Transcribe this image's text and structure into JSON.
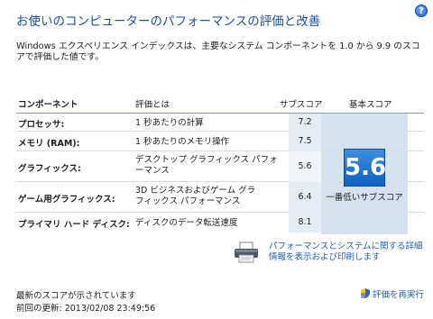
{
  "header": {
    "title": "お使いのコンピューターのパフォーマンスの評価と改善",
    "description": "Windows エクスペリエンス インデックスは、主要なシステム コンポーネントを 1.0 から 9.9 のスコアで評価した値です。",
    "help_icon": "?"
  },
  "table": {
    "headers": {
      "component": "コンポーネント",
      "rated": "評価とは",
      "subscore": "サブスコア",
      "basescore": "基本スコア"
    },
    "rows": [
      {
        "component": "プロセッサ:",
        "rated": "1 秒あたりの計算",
        "subscore": "7.2"
      },
      {
        "component": "メモリ (RAM):",
        "rated": "1 秒あたりのメモリ操作",
        "subscore": "7.5"
      },
      {
        "component": "グラフィックス:",
        "rated": "デスクトップ グラフィックス パフォーマンス",
        "subscore": "5.6"
      },
      {
        "component": "ゲーム用グラフィックス:",
        "rated": "3D ビジネスおよびゲーム グラフィックス パフォーマンス",
        "subscore": "6.4"
      },
      {
        "component": "プライマリ ハード ディスク:",
        "rated": "ディスクのデータ転送速度",
        "subscore": "8.1"
      }
    ]
  },
  "base_score": {
    "value": "5.6",
    "caption": "一番低いサブスコア"
  },
  "links": {
    "details": "パフォーマンスとシステムに関する詳細情報を表示および印刷します",
    "rerun": "評価を再実行"
  },
  "footer": {
    "status": "最新のスコアが示されています",
    "last_update": "前回の更新: 2013/02/08 23:49:56"
  },
  "colors": {
    "title": "#1f4fa0",
    "link": "#1f5fb5",
    "badge": "#1160c2"
  },
  "icons": {
    "help": "help-icon",
    "printer": "printer-icon",
    "shield": "shield-icon"
  }
}
